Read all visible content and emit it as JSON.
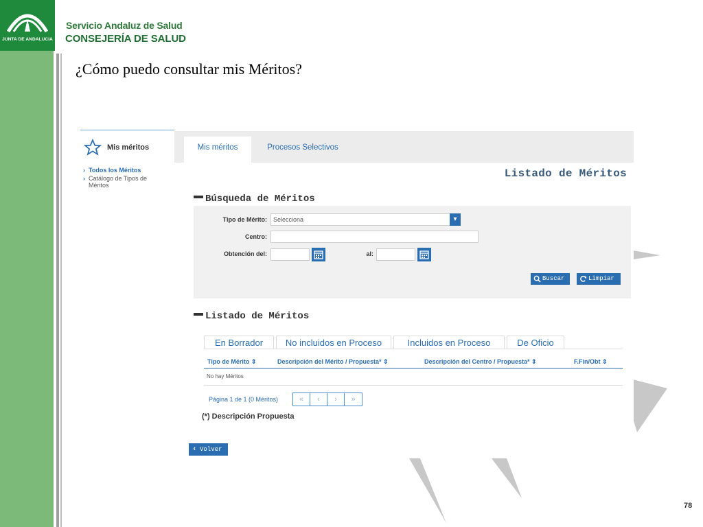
{
  "header": {
    "logo_text": "JUNTA DE ANDALUCIA",
    "org_line1": "Servicio Andaluz de Salud",
    "org_line2": "CONSEJERÍA DE SALUD"
  },
  "slide": {
    "title": "¿Cómo puedo consultar mis Méritos?",
    "page_number": "78"
  },
  "sidebar": {
    "title": "Mis méritos",
    "items": [
      {
        "label": "Todos los Méritos",
        "active": true
      },
      {
        "label": "Catálogo de Tipos de",
        "label2": "Méritos",
        "active": false
      }
    ]
  },
  "tabs": [
    {
      "label": "Mis méritos",
      "active": true
    },
    {
      "label": "Procesos Selectivos",
      "active": false
    }
  ],
  "page_title": "Listado de Méritos",
  "search": {
    "section_title": "Búsqueda de Méritos",
    "tipo_label": "Tipo de Mérito:",
    "tipo_value": "Selecciona",
    "centro_label": "Centro:",
    "centro_value": "",
    "obtencion_label": "Obtención del:",
    "al_label": "al:",
    "buscar_label": "Buscar",
    "limpiar_label": "Limpiar"
  },
  "results": {
    "section_title": "Listado de Méritos",
    "tabs": [
      "En Borrador",
      "No incluidos en Proceso",
      "Incluidos en Proceso",
      "De Oficio"
    ],
    "columns": [
      "Tipo de Mérito  ⇕",
      "Descripción del Mérito / Propuesta*  ⇕",
      "Descripción del Centro / Propuesta*  ⇕",
      "F.Fin/Obt  ⇕"
    ],
    "empty_text": "No hay Méritos",
    "pager_text": "Página 1 de 1 (0 Méritos)",
    "pager_buttons": [
      "«",
      "‹",
      "›",
      "»"
    ],
    "note": "(*) Descripción Propuesta",
    "back_label": "Volver"
  },
  "colors": {
    "accent": "#2a6db0",
    "green_band": "#7cba79",
    "logo_green": "#1f8a3c"
  }
}
